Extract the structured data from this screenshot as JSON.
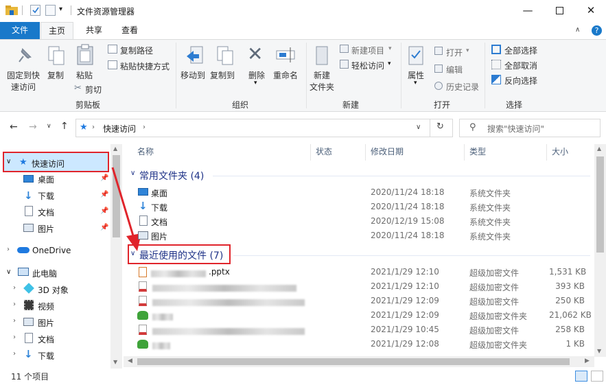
{
  "window": {
    "title": "文件资源管理器"
  },
  "tabs": {
    "file": "文件",
    "home": "主页",
    "share": "共享",
    "view": "查看"
  },
  "ribbon": {
    "pin": "固定到快\n速访问",
    "pin_l1": "固定到快",
    "pin_l2": "速访问",
    "copy": "复制",
    "paste": "粘贴",
    "copy_path": "复制路径",
    "paste_shortcut": "粘贴快捷方式",
    "cut": "剪切",
    "group_clipboard": "剪贴板",
    "move_to": "移动到",
    "copy_to": "复制到",
    "delete": "删除",
    "rename": "重命名",
    "group_organize": "组织",
    "new_folder_l1": "新建",
    "new_folder_l2": "文件夹",
    "new_item": "新建项目",
    "easy_access": "轻松访问",
    "group_new": "新建",
    "properties": "属性",
    "open": "打开",
    "edit": "编辑",
    "history": "历史记录",
    "group_open": "打开",
    "select_all": "全部选择",
    "select_none": "全部取消",
    "invert": "反向选择",
    "group_select": "选择"
  },
  "address": {
    "path": "快速访问",
    "search_placeholder": "搜索\"快速访问\""
  },
  "nav": {
    "quick_access": "快速访问",
    "qa_items": [
      "桌面",
      "下载",
      "文档",
      "图片"
    ],
    "onedrive": "OneDrive",
    "this_pc": "此电脑",
    "pc_items": [
      "3D 对象",
      "视频",
      "图片",
      "文档",
      "下载"
    ]
  },
  "columns": {
    "name": "名称",
    "status": "状态",
    "modified": "修改日期",
    "type": "类型",
    "size": "大小"
  },
  "groups": {
    "frequent": "常用文件夹 (4)",
    "recent": "最近使用的文件 (7)"
  },
  "frequent": [
    {
      "name": "桌面",
      "date": "2020/11/24 18:18",
      "type": "系统文件夹",
      "icon": "desktop-folder-icon"
    },
    {
      "name": "下载",
      "date": "2020/11/24 18:18",
      "type": "系统文件夹",
      "icon": "download-folder-icon"
    },
    {
      "name": "文档",
      "date": "2020/12/19 15:08",
      "type": "系统文件夹",
      "icon": "documents-folder-icon"
    },
    {
      "name": "图片",
      "date": "2020/11/24 18:18",
      "type": "系统文件夹",
      "icon": "pictures-folder-icon"
    }
  ],
  "recent": [
    {
      "name": ".pptx",
      "date": "2021/1/29 12:10",
      "type": "超级加密文件",
      "size": "1,531 KB"
    },
    {
      "name": "",
      "date": "2021/1/29 12:10",
      "type": "超级加密文件",
      "size": "393 KB"
    },
    {
      "name": "",
      "date": "2021/1/29 12:09",
      "type": "超级加密文件",
      "size": "250 KB"
    },
    {
      "name": "",
      "date": "2021/1/29 12:09",
      "type": "超级加密文件夹",
      "size": "21,062 KB"
    },
    {
      "name": "",
      "date": "2021/1/29 10:45",
      "type": "超级加密文件",
      "size": "258 KB"
    },
    {
      "name": "",
      "date": "2021/1/29 12:08",
      "type": "超级加密文件夹",
      "size": "1 KB"
    }
  ],
  "status": {
    "count": "11 个项目"
  },
  "colors": {
    "accent": "#1979ca",
    "highlight": "#e0242b",
    "selected": "#cce8ff"
  }
}
